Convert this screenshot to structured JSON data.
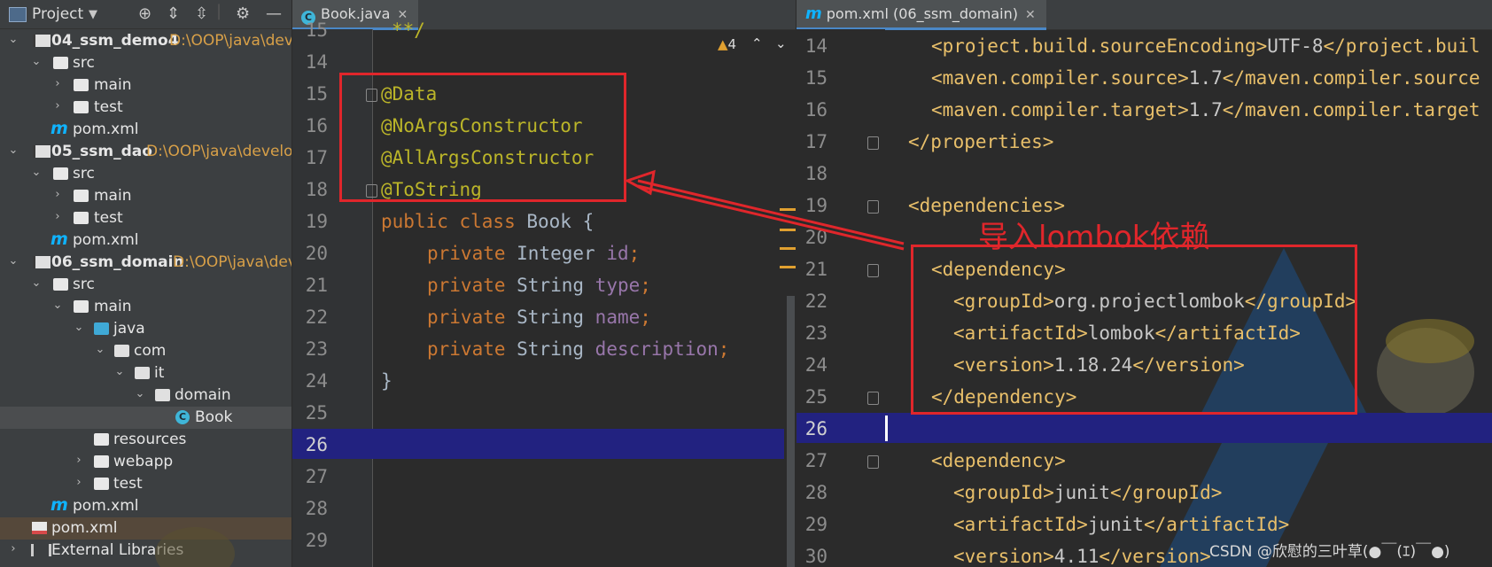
{
  "project_panel": {
    "title": "Project",
    "tree": [
      {
        "label": "04_ssm_demo4",
        "path": "D:\\OOP\\java\\deve"
      },
      {
        "label": "src"
      },
      {
        "label": "main"
      },
      {
        "label": "test"
      },
      {
        "label": "pom.xml"
      },
      {
        "label": "05_ssm_dao",
        "path": "D:\\OOP\\java\\develop_"
      },
      {
        "label": "src"
      },
      {
        "label": "main"
      },
      {
        "label": "test"
      },
      {
        "label": "pom.xml"
      },
      {
        "label": "06_ssm_domain",
        "path": "D:\\OOP\\java\\deve"
      },
      {
        "label": "src"
      },
      {
        "label": "main"
      },
      {
        "label": "java"
      },
      {
        "label": "com"
      },
      {
        "label": "it"
      },
      {
        "label": "domain"
      },
      {
        "label": "Book"
      },
      {
        "label": "resources"
      },
      {
        "label": "webapp"
      },
      {
        "label": "test"
      },
      {
        "label": "pom.xml"
      },
      {
        "label": "pom.xml"
      },
      {
        "label": "External Libraries"
      }
    ]
  },
  "editor_left": {
    "tab": "Book.java",
    "warning_count": "4",
    "line_numbers": [
      "15",
      "14",
      "15",
      "16",
      "17",
      "18",
      "19",
      "20",
      "21",
      "22",
      "23",
      "24",
      "25",
      "26",
      "27",
      "28",
      "29"
    ],
    "lines": {
      "l13": "**/",
      "l15": "@Data",
      "l16": "@NoArgsConstructor",
      "l17": "@AllArgsConstructor",
      "l18": "@ToString",
      "l19a": "public class ",
      "l19b": "Book {",
      "priv": "private ",
      "t20": "Integer ",
      "f20": "id",
      "s": ";",
      "t21": "String ",
      "f21": "type",
      "t22": "String ",
      "f22": "name",
      "t23": "String ",
      "f23": "description",
      "l24": "}"
    }
  },
  "editor_right": {
    "tab": "pom.xml (06_ssm_domain)",
    "line_numbers": [
      "14",
      "15",
      "16",
      "17",
      "18",
      "19",
      "20",
      "21",
      "22",
      "23",
      "24",
      "25",
      "26",
      "27",
      "28",
      "29",
      "30"
    ],
    "lines": {
      "l14a": "<project.build.sourceEncoding>",
      "l14b": "UTF-8",
      "l14c": "</project.buil",
      "l15a": "<maven.compiler.source>",
      "l15b": "1.7",
      "l15c": "</maven.compiler.source",
      "l16a": "<maven.compiler.target>",
      "l16b": "1.7",
      "l16c": "</maven.compiler.target",
      "l17": "</properties>",
      "l19": "<dependencies>",
      "l21": "<dependency>",
      "l22a": "<groupId>",
      "l22b": "org.projectlombok",
      "l22c": "</groupId>",
      "l23a": "<artifactId>",
      "l23b": "lombok",
      "l23c": "</artifactId>",
      "l24a": "<version>",
      "l24b": "1.18.24",
      "l24c": "</version>",
      "l25": "</dependency>",
      "l27": "<dependency>",
      "l28a": "<groupId>",
      "l28b": "junit",
      "l28c": "</groupId>",
      "l29a": "<artifactId>",
      "l29b": "junit",
      "l29c": "</artifactId>",
      "l30a": "<version>",
      "l30b": "4.11",
      "l30c": "</version>"
    },
    "annotation_label": "导入lombok依赖",
    "watermark": "CSDN @欣慰的三叶草(●￣(ｴ)￣●)"
  },
  "colors": {
    "annotation_red": "#e0262b",
    "current_line": "#222280"
  }
}
